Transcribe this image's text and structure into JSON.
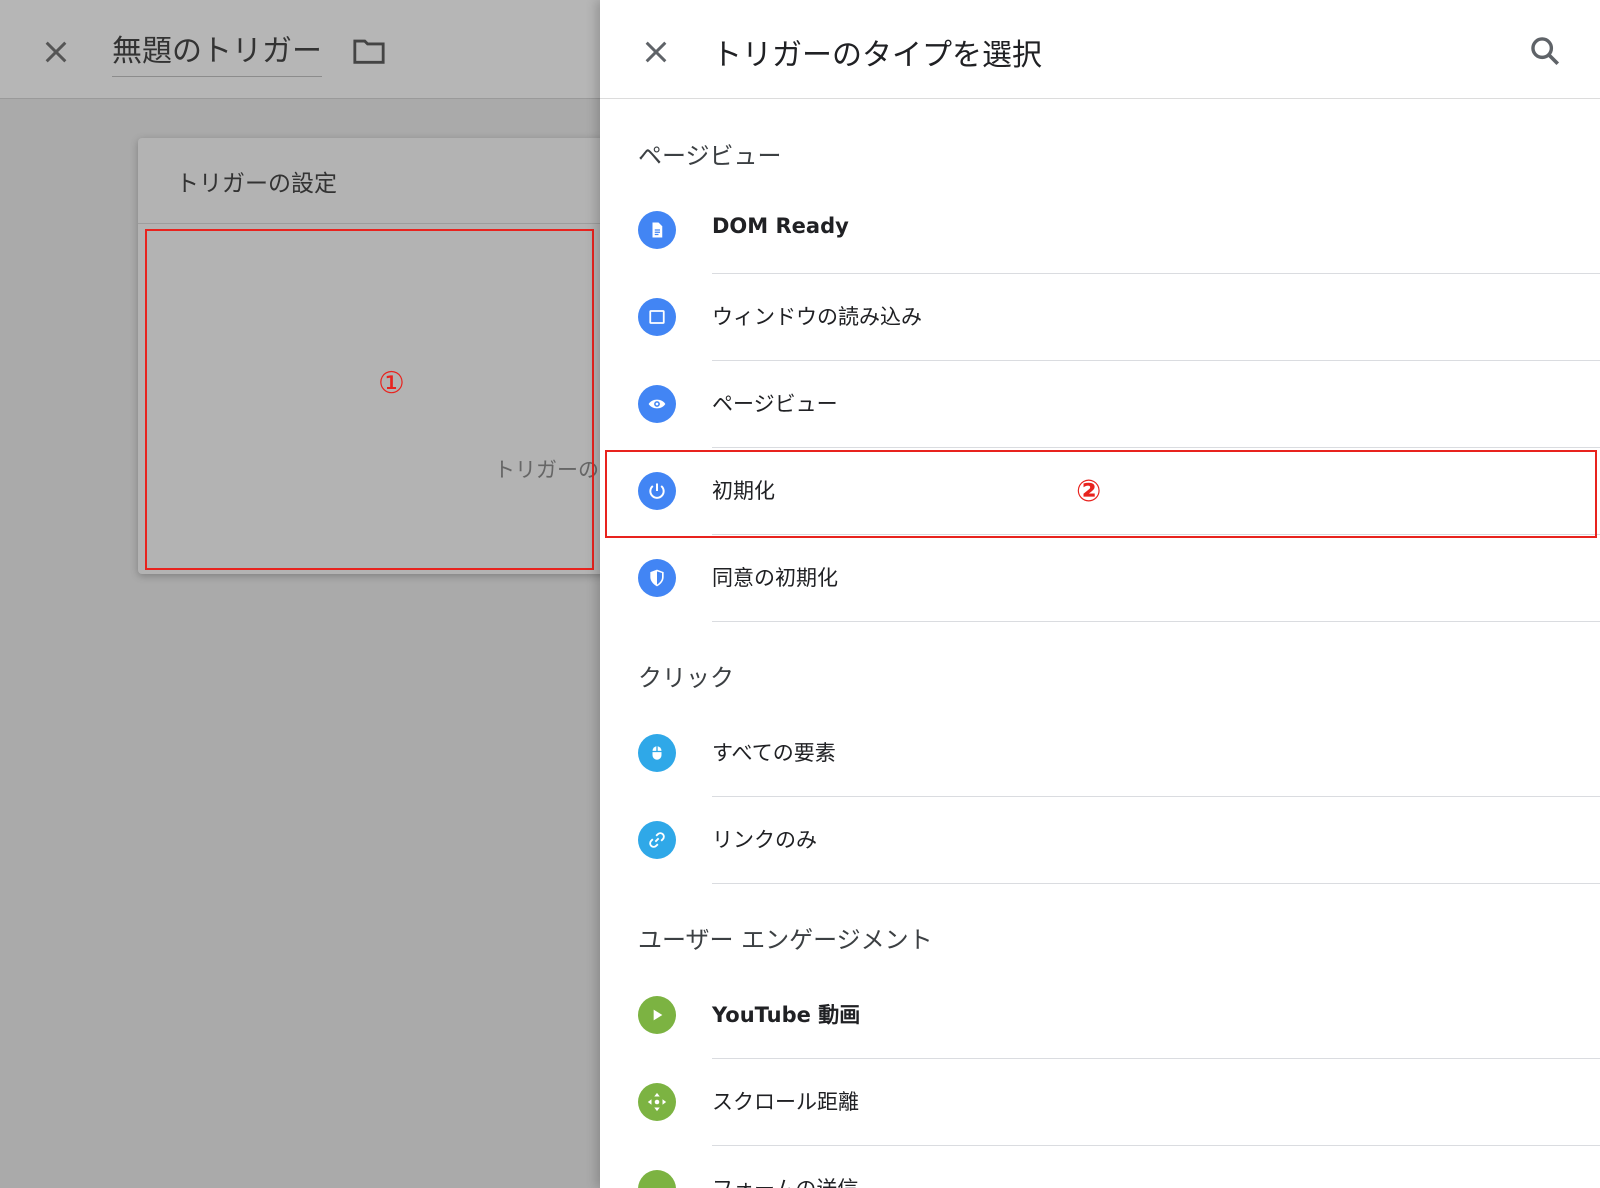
{
  "background": {
    "title": "無題のトリガー",
    "card_title": "トリガーの設定",
    "card_placeholder": "トリガーの"
  },
  "panel": {
    "title": "トリガーのタイプを選択",
    "sections": [
      {
        "title": "ページビュー",
        "items": [
          {
            "label": "DOM Ready",
            "icon": "document-icon"
          },
          {
            "label": "ウィンドウの読み込み",
            "icon": "window-icon"
          },
          {
            "label": "ページビュー",
            "icon": "eye-icon"
          },
          {
            "label": "初期化",
            "icon": "power-icon"
          },
          {
            "label": "同意の初期化",
            "icon": "shield-icon"
          }
        ]
      },
      {
        "title": "クリック",
        "items": [
          {
            "label": "すべての要素",
            "icon": "mouse-icon"
          },
          {
            "label": "リンクのみ",
            "icon": "link-icon"
          }
        ]
      },
      {
        "title": "ユーザー エンゲージメント",
        "items": [
          {
            "label": "YouTube 動画",
            "icon": "play-icon"
          },
          {
            "label": "スクロール距離",
            "icon": "scroll-icon"
          },
          {
            "label": "フォームの送信",
            "icon": "form-icon"
          }
        ]
      }
    ]
  },
  "annotations": {
    "first": "①",
    "second": "②"
  },
  "colors": {
    "accent_blue": "#4285f4",
    "light_blue": "#2fa8e8",
    "green": "#7cb342",
    "annotation_red": "#e8231e"
  }
}
